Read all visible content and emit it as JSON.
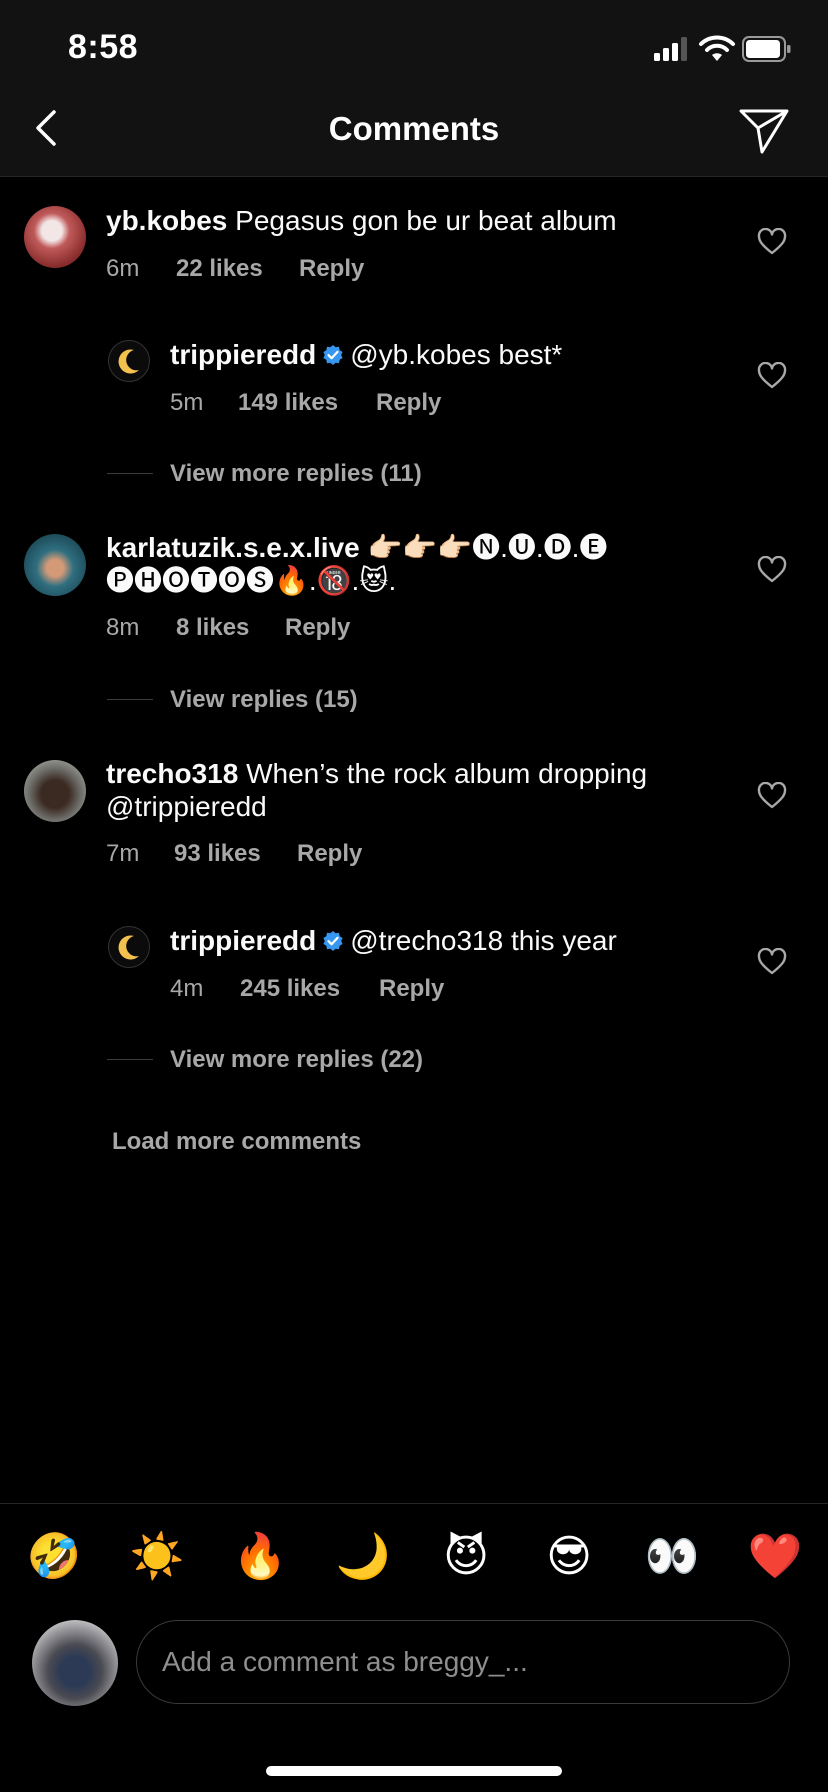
{
  "status": {
    "time": "8:58"
  },
  "header": {
    "title": "Comments"
  },
  "comments": [
    {
      "username": "yb.kobes",
      "text": "Pegasus gon be ur beat album",
      "time": "6m",
      "likes": "22 likes",
      "reply": "Reply",
      "replies": [
        {
          "username": "trippieredd",
          "verified": true,
          "text": "@yb.kobes best*",
          "time": "5m",
          "likes": "149 likes",
          "reply": "Reply"
        }
      ],
      "view_more": "View more replies (11)"
    },
    {
      "username": "karlatuzik.s.e.x.live",
      "text_line1": "👉🏻👉🏻👉🏻🅝.🅤.🅓.🅔",
      "text_line2": "🅟🅗🅞🅣🅞🅢🔥.🔞.😻.",
      "time": "8m",
      "likes": "8 likes",
      "reply": "Reply",
      "view_more": "View replies (15)"
    },
    {
      "username": "trecho318",
      "text_line1": "When’s the rock album dropping",
      "text_line2": "@trippieredd",
      "time": "7m",
      "likes": "93 likes",
      "reply": "Reply",
      "replies": [
        {
          "username": "trippieredd",
          "verified": true,
          "text": "@trecho318 this year",
          "time": "4m",
          "likes": "245 likes",
          "reply": "Reply"
        }
      ],
      "view_more": "View more replies (22)"
    }
  ],
  "load_more": "Load more comments",
  "quick_emojis": [
    "🤣",
    "☀️",
    "🔥",
    "🌙",
    "😈",
    "😎",
    "👀",
    "❤️"
  ],
  "composer": {
    "placeholder": "Add a comment as breggy_..."
  },
  "colors": {
    "background": "#000000",
    "header": "#121212",
    "secondary_text": "#a8a8a8",
    "verified": "#3797f0"
  }
}
